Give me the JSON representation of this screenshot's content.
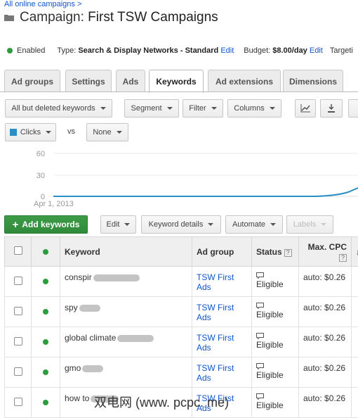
{
  "breadcrumb": "All online campaigns >",
  "campaign": {
    "prefix": "Campaign:",
    "name": "First TSW Campaigns"
  },
  "info": {
    "status": "Enabled",
    "type_label": "Type:",
    "type_value": "Search & Display Networks - Standard",
    "edit": "Edit",
    "budget_label": "Budget:",
    "budget_value": "$8.00/day",
    "edit2": "Edit",
    "targeting": "Targeti"
  },
  "tabs": [
    "Ad groups",
    "Settings",
    "Ads",
    "Keywords",
    "Ad extensions",
    "Dimensions"
  ],
  "active_tab": "Keywords",
  "toolbar": {
    "filter": "All but deleted keywords",
    "segment": "Segment",
    "filter_btn": "Filter",
    "columns": "Columns"
  },
  "chart": {
    "metric1": "Clicks",
    "vs": "vs",
    "metric2": "None",
    "metric1_color": "#2a8fc4"
  },
  "chart_data": {
    "type": "line",
    "y_ticks": [
      "60",
      "30",
      "0"
    ],
    "x_start_label": "Apr 1, 2013",
    "ylim": [
      0,
      60
    ]
  },
  "actions": {
    "add": "Add keywords",
    "edit": "Edit",
    "keyword_details": "Keyword details",
    "automate": "Automate",
    "labels": "Labels"
  },
  "table": {
    "headers": {
      "keyword": "Keyword",
      "ad_group": "Ad group",
      "status": "Status",
      "max_cpc": "Max. CPC"
    },
    "rows": [
      {
        "keyword": "conspir",
        "ad_group": "TSW First Ads",
        "status": "Eligible",
        "cpc": "auto: $0.26"
      },
      {
        "keyword": "spy",
        "ad_group": "TSW First Ads",
        "status": "Eligible",
        "cpc": "auto: $0.26"
      },
      {
        "keyword": "global climate",
        "ad_group": "TSW First Ads",
        "status": "Eligible",
        "cpc": "auto: $0.26"
      },
      {
        "keyword": "gmo",
        "ad_group": "TSW First Ads",
        "status": "Eligible",
        "cpc": "auto: $0.26"
      },
      {
        "keyword": "how to",
        "ad_group": "TSW First Ads",
        "status": "Eligible",
        "cpc": "auto: $0.26"
      }
    ]
  },
  "watermark": "双电网 (www. pcpc. me)"
}
